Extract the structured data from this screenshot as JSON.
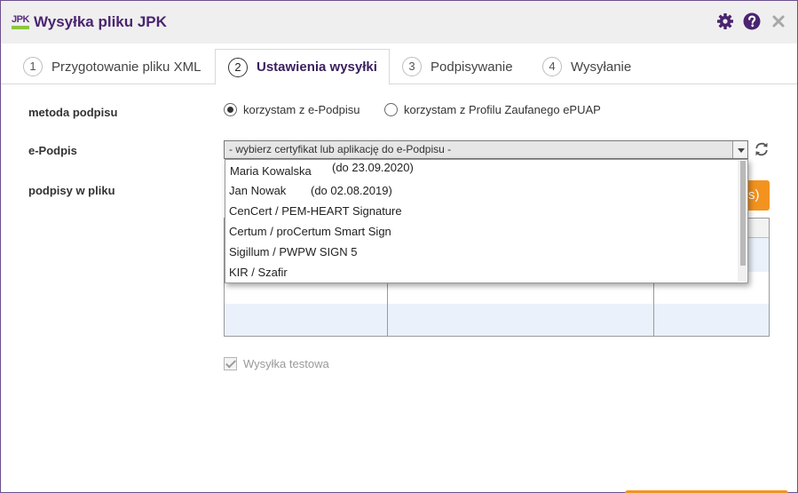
{
  "window": {
    "logo_text": "JPK",
    "title": "Wysyłka pliku JPK"
  },
  "tabs": [
    {
      "num": "1",
      "label": "Przygotowanie pliku XML"
    },
    {
      "num": "2",
      "label": "Ustawienia wysyłki"
    },
    {
      "num": "3",
      "label": "Podpisywanie"
    },
    {
      "num": "4",
      "label": "Wysyłanie"
    }
  ],
  "form": {
    "signing_method_label": "metoda podpisu",
    "radio_epodpis": "korzystam z e-Podpisu",
    "radio_epuap": "korzystam z Profilu Zaufanego ePUAP",
    "epodpis_label": "e-Podpis",
    "select_value": "- wybierz certyfikat lub aplikację do e-Podpisu -",
    "signatures_label": "podpisy w pliku",
    "orange_button_visible_text": "s)",
    "test_send_label": "Wysyłka testowa"
  },
  "dropdown_options": [
    {
      "name": "Maria Kowalska",
      "date": "(do 23.09.2020)"
    },
    {
      "name": "Jan Nowak",
      "date": "(do 02.08.2019)"
    },
    {
      "name": "CenCert / PEM-HEART Signature",
      "date": ""
    },
    {
      "name": "Certum / proCertum Smart Sign",
      "date": ""
    },
    {
      "name": "Sigillum / PWPW SIGN 5",
      "date": ""
    },
    {
      "name": "KIR / Szafir",
      "date": ""
    }
  ],
  "colors": {
    "accent": "#5a2d82",
    "orange": "#f2931f",
    "logo_green": "#8cc63f"
  },
  "icons": {
    "settings": "gear-icon",
    "help": "help-icon",
    "close": "close-icon",
    "refresh": "refresh-icon"
  }
}
